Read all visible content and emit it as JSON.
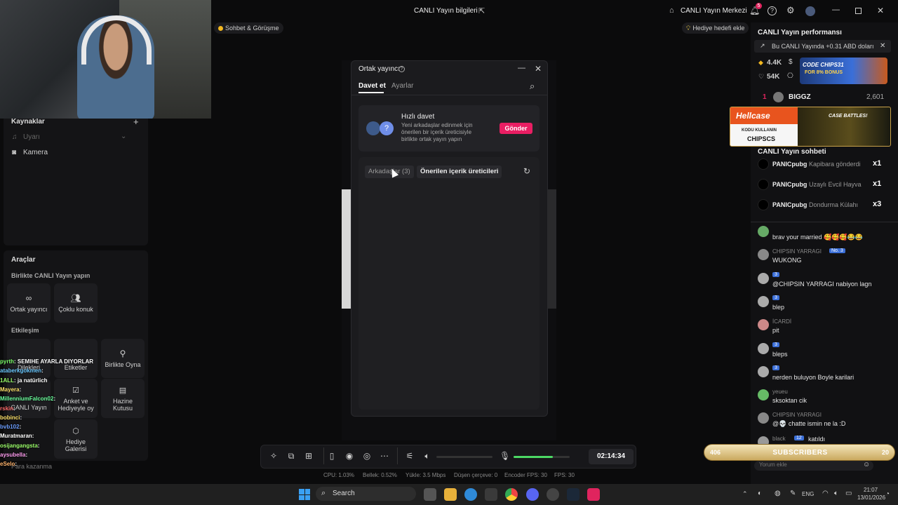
{
  "topbar": {
    "title": "CANLI Yayın bilgileri",
    "center_btn": "CANLI Yayın Merkezi",
    "notif_count": "5",
    "left_tag": "Sohbet & Görüşme",
    "gift_goal": "Hediye hedefi ekle"
  },
  "left": {
    "sources_title": "Kaynaklar",
    "source_1": "Uyarı",
    "source_2": "Kamera",
    "tools_title": "Araçlar",
    "coop_title": "Birlikte CANLI Yayın yapın",
    "tile_cohost": "Ortak yayıncı",
    "tile_multi": "Çoklu konuk",
    "interaction_title": "Etkileşim",
    "tile_wishes": "Dilekleri",
    "tile_stickers": "Etiketler",
    "tile_playtogether": "Birlikte Oyna",
    "tile_canli": "CANLI Yayın",
    "tile_poll": "Anket ve Hediyeyle oy",
    "tile_treasure": "Hazine Kutusu",
    "tile_gallery": "Hediye Galerisi",
    "bottom_label": "Para kazanma"
  },
  "overlay_chat": [
    {
      "user": "pyrth",
      "msg": ": SEMIHE AYARLA DIYORLAR",
      "color": "#7dff6b"
    },
    {
      "user": "ataberkgokmen",
      "msg": ":",
      "color": "#6bc8ff"
    },
    {
      "user": "1ALL",
      "msg": ": ja natürlich",
      "color": "#9dff6b"
    },
    {
      "user": "Mayera",
      "msg": ":",
      "color": "#ffe36b"
    },
    {
      "user": "MillenniumFalcon02",
      "msg": ":",
      "color": "#6bff9d"
    },
    {
      "user": "rskin",
      "msg": ":",
      "color": "#ff6b6b"
    },
    {
      "user": "bobinci",
      "msg": ":",
      "color": "#ffe36b"
    },
    {
      "user": "bvb102",
      "msg": ":",
      "color": "#6b9dff"
    },
    {
      "user": "Muratmaran",
      "msg": ":",
      "color": "#ffffff"
    },
    {
      "user": "osijangangsta",
      "msg": ":",
      "color": "#9dff6b"
    },
    {
      "user": "aysubella",
      "msg": ":",
      "color": "#ff9df0"
    },
    {
      "user": "eSelo",
      "msg": ":",
      "color": "#ffb36b"
    }
  ],
  "modal": {
    "title": "Ortak yayıncı",
    "tab_invite": "Davet et",
    "tab_settings": "Ayarlar",
    "quick_title": "Hızlı davet",
    "quick_desc": "Yeni arkadaşlar edinmek için önerilen bir içerik üreticisiyle birlikte ortak yayın yapın",
    "send_btn": "Gönder",
    "pill_friends": "Arkadaşlar (3)",
    "pill_suggested": "Önerilen içerik üreticileri"
  },
  "toolbar": {
    "timer": "02:14:34",
    "mic_level": 0.7
  },
  "stats": {
    "cpu": "CPU: 1.03%",
    "mem": "Bellek: 0.52%",
    "upload": "Yükle: 3.5 Mbps",
    "drop": "Düşen çerçeve: 0",
    "encoder": "Encoder FPS: 30",
    "fps": "FPS: 30"
  },
  "right": {
    "perf_title": "CANLI Yayın performansı",
    "earn_text": "Bu CANLI Yayında +0.31 ABD doları",
    "diamonds": "4.4K",
    "likes": "54K",
    "top_rank": "1",
    "top_user": "BIGGZ",
    "top_score": "2,601",
    "ad_code": "CODE CHIPS31",
    "ad_bonus": "FOR 8% BONUS",
    "hellcase": "Hellcase",
    "hellcase_code_label": "KODU KULLANIN",
    "hellcase_code": "CHIPSCS",
    "case_battles": "CASE BATTLES!",
    "chat_title": "CANLI Yayın sohbeti",
    "gifts": [
      {
        "user": "PANICpubg",
        "gift": "Kapibara gönderdi",
        "count": "x1"
      },
      {
        "user": "PANICpubg",
        "gift": "Uzaylı Evcil Hayva",
        "count": "x1"
      },
      {
        "user": "PANICpubg",
        "gift": "Dondurma Külahı",
        "count": "x3"
      }
    ],
    "messages": [
      {
        "user": "",
        "badge": "",
        "text": "brav your married 🥰🥰🥰😂😂",
        "color": "#6a6"
      },
      {
        "user": "CHIPSIN YARRAGI",
        "badge": "No. 3",
        "text": "WUKONG",
        "color": "#888"
      },
      {
        "user": "",
        "badge": "3",
        "text": "@CHIPSIN YARRAGI nabiyon lagn",
        "color": "#aaa"
      },
      {
        "user": "",
        "badge": "3",
        "text": "blep",
        "color": "#aaa"
      },
      {
        "user": "İCARDİ",
        "badge": "",
        "text": "pit",
        "color": "#c88"
      },
      {
        "user": "",
        "badge": "3",
        "text": "bleps",
        "color": "#aaa"
      },
      {
        "user": "",
        "badge": "3",
        "text": "nerden buluyon Boyle karilari",
        "color": "#aaa"
      },
      {
        "user": "yeueu",
        "badge": "",
        "text": "sksoktan cik",
        "color": "#6b6"
      },
      {
        "user": "CHIPSIN YARRAGI",
        "badge": "",
        "text": "@💀 chatte ismin ne la :D",
        "color": "#888"
      },
      {
        "user": "black",
        "badge": "12",
        "text": "katıldı",
        "color": "#999"
      }
    ],
    "sub_left": "406",
    "sub_label": "SUBSCRIBERS",
    "sub_right": "20",
    "comment_placeholder": "Yorum ekle"
  },
  "taskbar": {
    "search": "Search",
    "lang": "ENG",
    "time": "21:07",
    "date": "13/01/2026"
  }
}
